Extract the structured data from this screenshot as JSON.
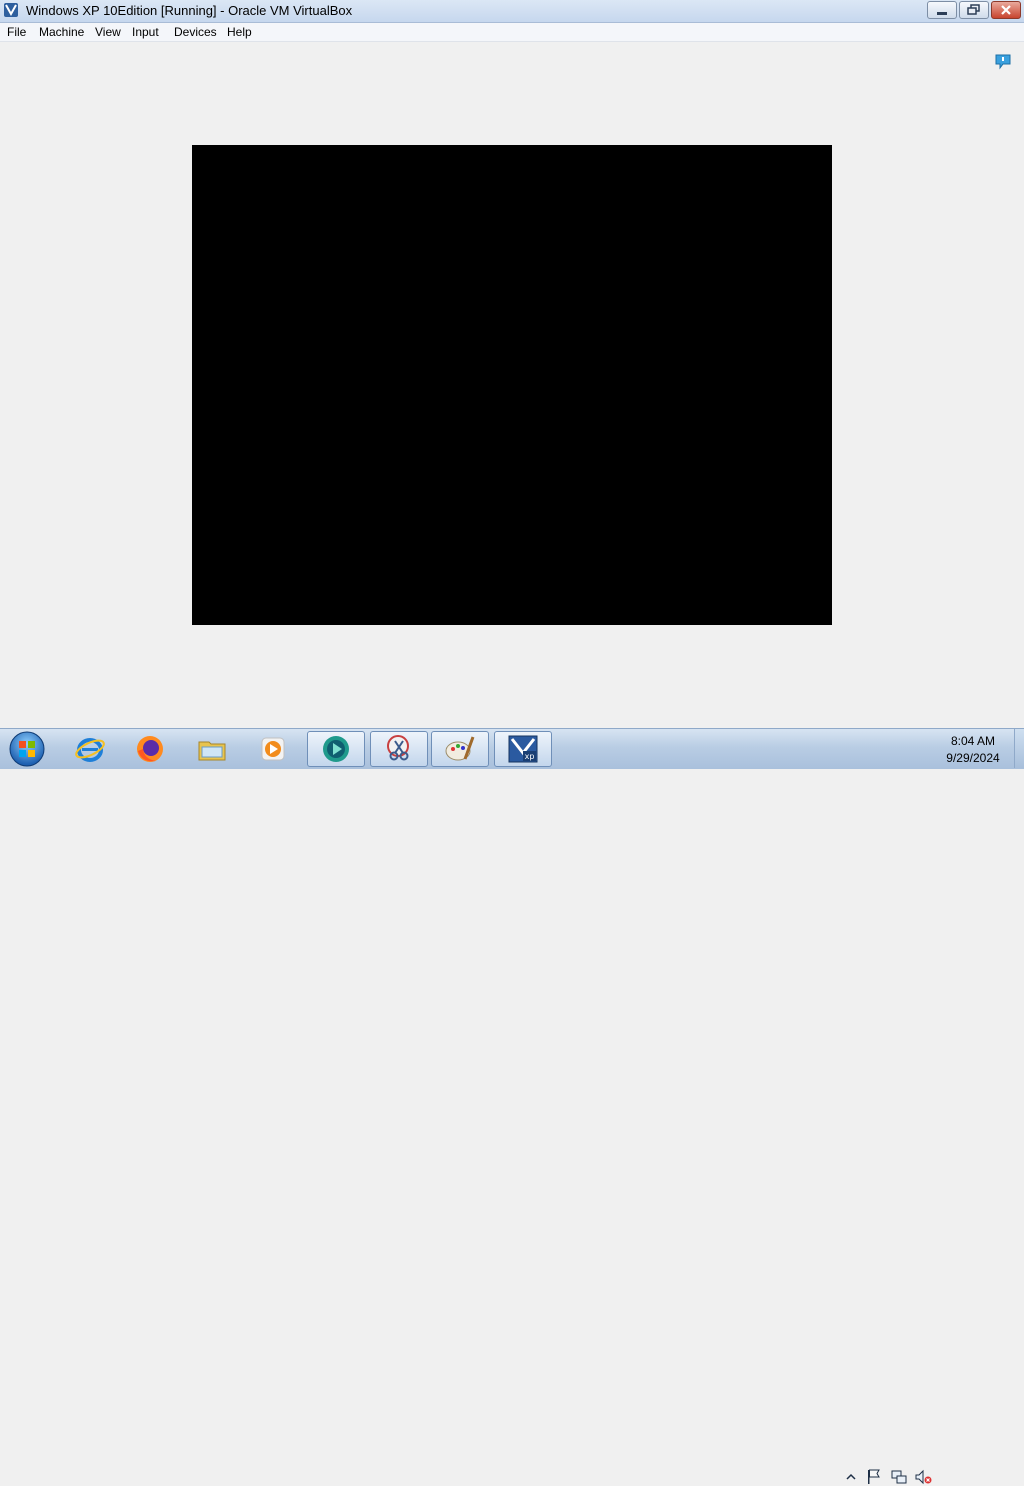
{
  "window": {
    "title": "Windows XP 10Edition [Running] - Oracle VM VirtualBox",
    "icon": "virtualbox-icon",
    "buttons": [
      "minimize-icon",
      "restore-icon",
      "close-icon"
    ]
  },
  "menu": {
    "items": [
      {
        "label": "File"
      },
      {
        "label": "Machine"
      },
      {
        "label": "View"
      },
      {
        "label": "Input"
      },
      {
        "label": "Devices"
      },
      {
        "label": "Help"
      }
    ]
  },
  "vm_display": {
    "state": "black screen",
    "background_color": "#000000"
  },
  "taskbar": {
    "start_icon": "windows-start-orb-icon",
    "pinned": [
      {
        "name": "internet-explorer-icon"
      },
      {
        "name": "firefox-icon"
      },
      {
        "name": "file-explorer-icon"
      },
      {
        "name": "media-player-icon"
      },
      {
        "name": "media-app-icon",
        "active": true
      },
      {
        "name": "snipping-tool-icon",
        "active": true
      },
      {
        "name": "paint-icon",
        "active": true
      },
      {
        "name": "virtualbox-xp-icon",
        "active": true
      }
    ],
    "tray": [
      "show-hidden-icons-icon",
      "action-center-flag-icon",
      "network-icon",
      "volume-muted-icon"
    ],
    "clock": {
      "time": "8:04 AM",
      "date": "9/29/2024"
    }
  }
}
